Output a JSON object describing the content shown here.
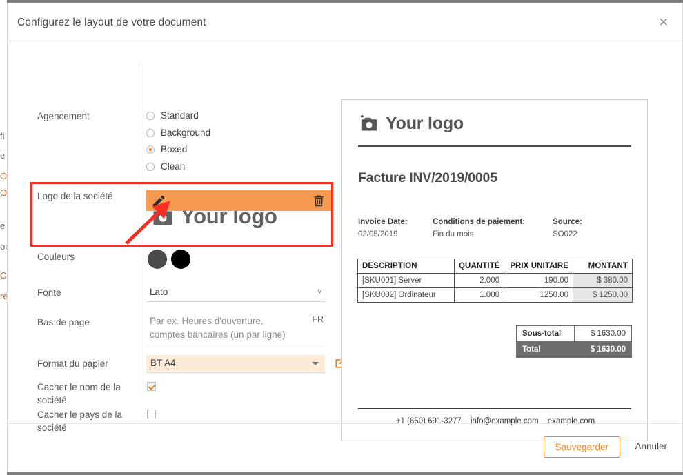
{
  "dialog": {
    "title": "Configurez le layout de votre document",
    "close_icon": "close-icon"
  },
  "background_page_fragments": [
    "fi",
    "e",
    "O",
    "O",
    "e",
    "oi",
    "C",
    "ré"
  ],
  "settings": {
    "layout": {
      "label": "Agencement",
      "options": [
        {
          "label": "Standard",
          "selected": false
        },
        {
          "label": "Background",
          "selected": false
        },
        {
          "label": "Boxed",
          "selected": true
        },
        {
          "label": "Clean",
          "selected": false
        }
      ]
    },
    "logo": {
      "label": "Logo de la société",
      "placeholder_text": "Your logo",
      "edit_icon": "pencil-icon",
      "delete_icon": "trash-icon",
      "toolbar_color": "#f79a52"
    },
    "colors": {
      "label": "Couleurs",
      "swatches": [
        "#4a4a4a",
        "#000000"
      ]
    },
    "font": {
      "label": "Fonte",
      "value": "Lato"
    },
    "footer": {
      "label": "Bas de page",
      "placeholder": "Par ex. Heures d'ouverture, comptes bancaires (un par ligne)",
      "lang": "FR"
    },
    "paper_format": {
      "label": "Format du papier",
      "value": "BT A4",
      "external_icon": "external-link-icon",
      "highlight_color": "#fdebd9"
    },
    "hide_company_name": {
      "label": "Cacher le nom de la société",
      "checked": true
    },
    "hide_company_country": {
      "label": "Cacher le pays de la société",
      "checked": false
    }
  },
  "preview": {
    "logo_text": "Your logo",
    "doc_title": "Facture INV/2019/0005",
    "meta": [
      {
        "label": "Invoice Date:",
        "value": "02/05/2019"
      },
      {
        "label": "Conditions de paiement:",
        "value": "Fin du mois"
      },
      {
        "label": "Source:",
        "value": "SO022"
      }
    ],
    "table": {
      "headers": [
        "DESCRIPTION",
        "QUANTITÉ",
        "PRIX UNITAIRE",
        "MONTANT"
      ],
      "rows": [
        {
          "description": "[SKU001] Server",
          "quantity": "2.000",
          "unit_price": "190.00",
          "amount": "$ 380.00"
        },
        {
          "description": "[SKU002] Ordinateur",
          "quantity": "1.000",
          "unit_price": "1250.00",
          "amount": "$ 1250.00"
        }
      ]
    },
    "totals": [
      {
        "label": "Sous-total",
        "value": "$ 1630.00"
      },
      {
        "label": "Total",
        "value": "$ 1630.00"
      }
    ],
    "footer": {
      "phone": "+1 (650) 691-3277",
      "email": "info@example.com",
      "website": "example.com"
    }
  },
  "footer_actions": {
    "save_label": "Sauvegarder",
    "cancel_label": "Annuler",
    "accent_color": "#f0861e"
  },
  "annotation": {
    "highlight_color": "#fa2f22"
  }
}
